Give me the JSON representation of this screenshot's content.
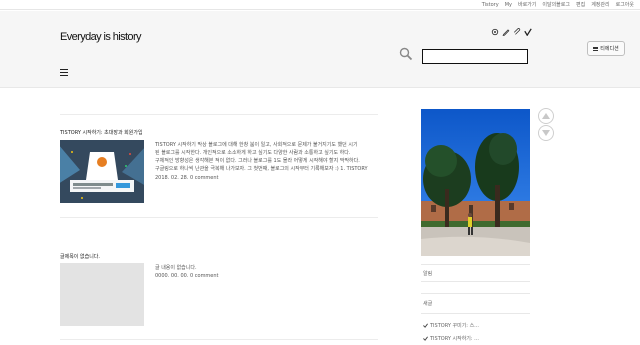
{
  "topbar": {
    "items": [
      "Tistory",
      "My",
      "바로가기",
      "이달의블로그",
      "편집",
      "계정관리",
      "로그아웃"
    ]
  },
  "header": {
    "site_title": "Everyday is history",
    "search": {
      "value": "",
      "placeholder": ""
    },
    "edition_button_label": "티에디션"
  },
  "posts": [
    {
      "title": "TISTORY 시작하기: 초대장과 회원가입",
      "excerpt_lines": [
        "TISTORY 시작하기 막상 블로그에 대해 한창 붐이 일고, 사회적으로 문제가 불거지기도 했던 시기",
        "된 블로그를 시작한다. 개인적으로 소소하게 하고 싶기도 다양한 사람과 소통하고 싶기도 하다.",
        "구체적인 방향성은 생각해본 적이 없다. 그러나 블로그를 1도 몰라 어떻게 시작해야 할지 막막하다.",
        "구글링으로 하나씩 난관을 극복해 나가보자. 그 첫번째, 블로그의 시작부터 기록해보자 :) 1. TISTORY"
      ],
      "meta": "2018. 02. 28.  0 comment"
    },
    {
      "title": "글제목이 없습니다.",
      "excerpt_lines": [
        "글 내용이 없습니다."
      ],
      "meta": "0000. 00. 00.  0 comment"
    }
  ],
  "sidebar": {
    "notice_label": "알림",
    "recent_label": "새글",
    "recent_items": [
      "TISTORY 꾸미기: 스...",
      "TISTORY 시작하기: ..."
    ]
  },
  "colors": {
    "header_bg": "#f6f6f6",
    "thumbnail_bg": "#34495e",
    "placeholder_thumb": "#e3e3e3"
  }
}
